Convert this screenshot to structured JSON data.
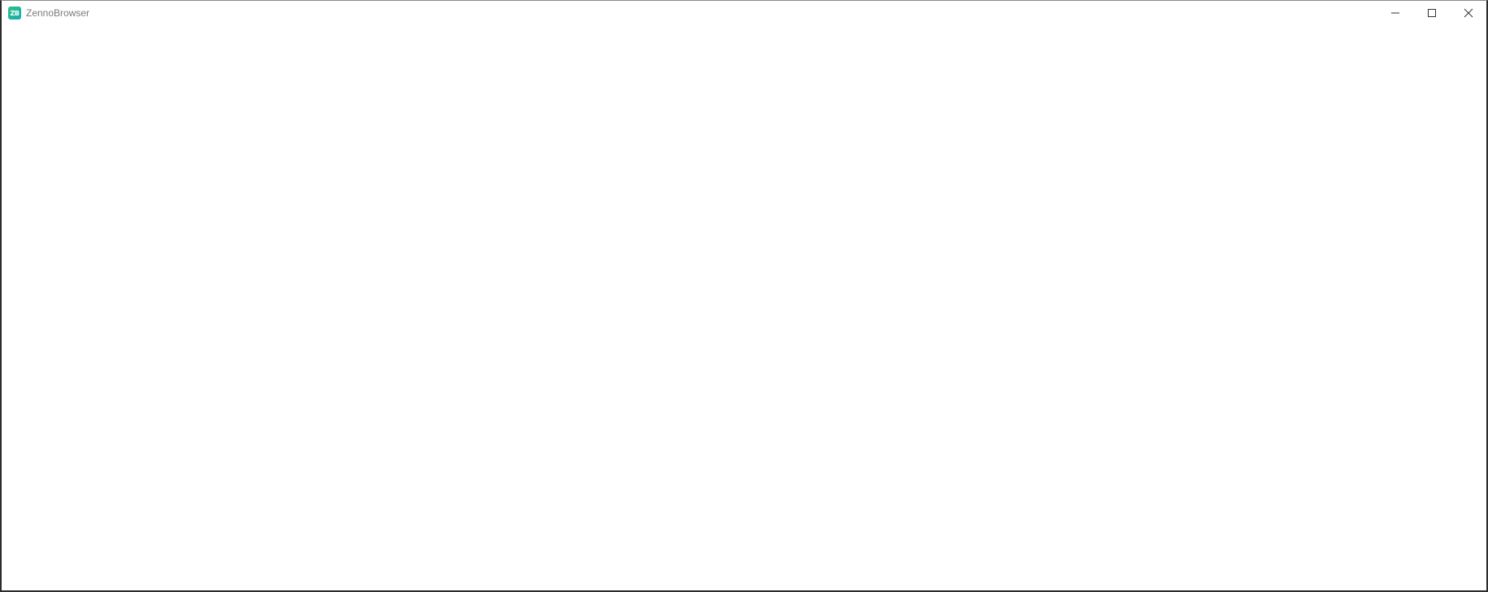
{
  "window": {
    "title": "ZennoBrowser",
    "icon_text": "ZB",
    "icon": "zennobrowser-logo-icon",
    "controls": [
      {
        "name": "minimize",
        "icon": "minimize-icon"
      },
      {
        "name": "maximize",
        "icon": "maximize-icon"
      },
      {
        "name": "close",
        "icon": "close-icon"
      }
    ]
  },
  "colors": {
    "accent_start": "#2ec27e",
    "accent_end": "#18a8b8",
    "title_text": "#7a7a7a",
    "background": "#ffffff"
  }
}
